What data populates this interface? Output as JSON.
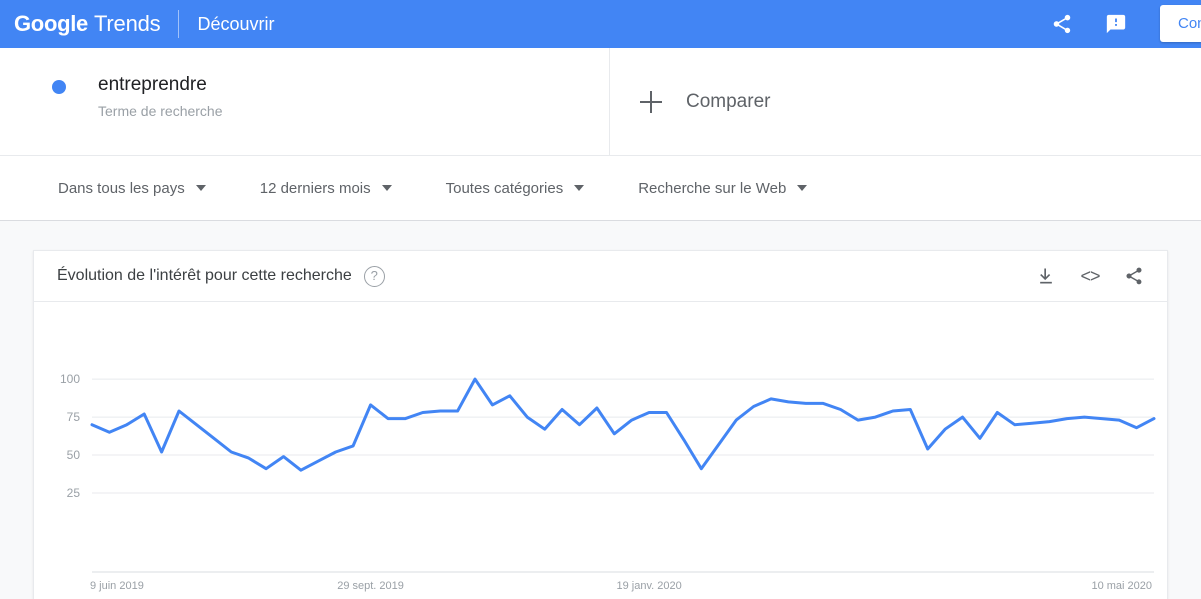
{
  "topbar": {
    "brand_google": "Google",
    "brand_trends": "Trends",
    "nav_discover": "Découvrir",
    "share_icon": "share-icon",
    "feedback_icon": "feedback-icon",
    "apps_icon": "apps-grid-icon",
    "signin_label": "Connexion",
    "background": "#4285f4"
  },
  "query": {
    "term": "entreprendre",
    "subtitle": "Terme de recherche",
    "dot_color": "#4285f4",
    "compare_label": "Comparer"
  },
  "filters": [
    {
      "label": "Dans tous les pays"
    },
    {
      "label": "12 derniers mois"
    },
    {
      "label": "Toutes catégories"
    },
    {
      "label": "Recherche sur le Web"
    }
  ],
  "card": {
    "title": "Évolution de l'intérêt pour cette recherche",
    "help_icon": "help-icon",
    "actions": [
      {
        "name": "download-icon"
      },
      {
        "name": "embed-icon",
        "glyph": "<>"
      },
      {
        "name": "share-icon"
      }
    ]
  },
  "chart_data": {
    "type": "line",
    "title": "Évolution de l'intérêt pour cette recherche",
    "xlabel": "",
    "ylabel": "",
    "ylim": [
      0,
      106
    ],
    "yticks": [
      100,
      75,
      50,
      25
    ],
    "grid": true,
    "legend": false,
    "line_color": "#4285f4",
    "x_tick_labels": [
      "9 juin 2019",
      "29 sept. 2019",
      "19 janv. 2020",
      "10 mai 2020"
    ],
    "x_tick_positions": [
      0,
      16,
      32,
      48
    ],
    "series": [
      {
        "name": "entreprendre",
        "values": [
          70,
          65,
          70,
          77,
          52,
          79,
          70,
          61,
          52,
          48,
          41,
          49,
          40,
          46,
          52,
          56,
          83,
          74,
          74,
          78,
          79,
          79,
          100,
          83,
          89,
          75,
          67,
          80,
          70,
          81,
          64,
          73,
          78,
          78,
          60,
          41,
          57,
          73,
          82,
          87,
          85,
          84,
          84,
          80,
          73,
          75,
          79,
          80,
          54,
          67,
          75,
          61,
          78,
          70,
          71,
          72,
          74,
          75,
          74,
          73,
          68,
          74
        ]
      }
    ]
  }
}
